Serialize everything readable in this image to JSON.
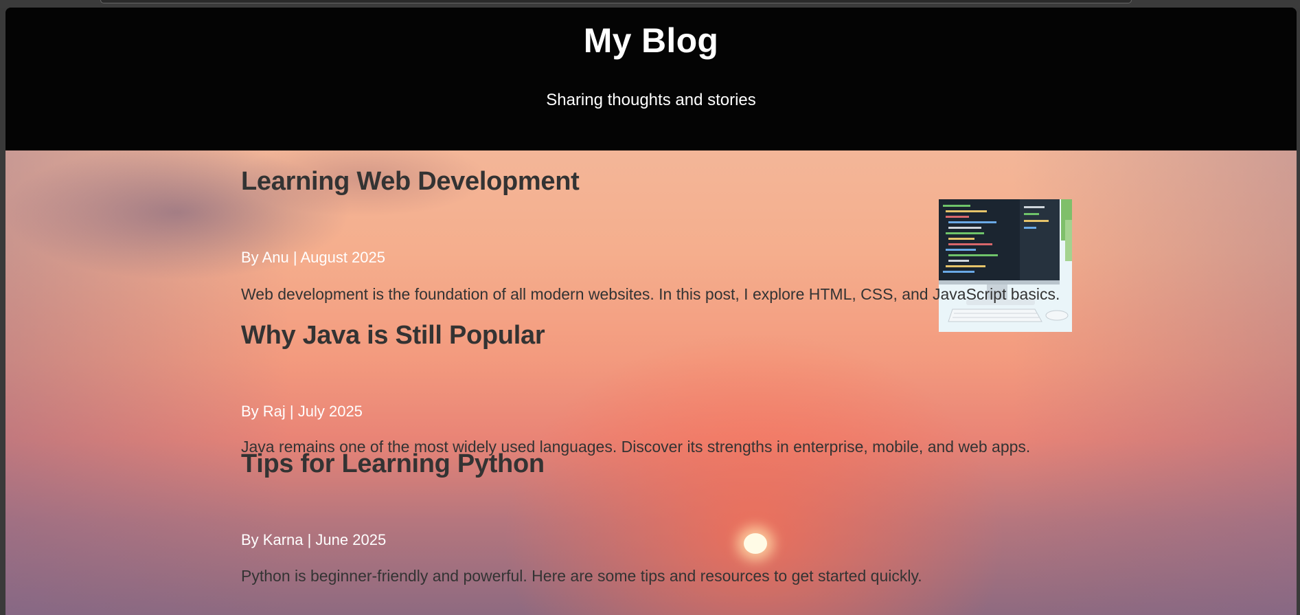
{
  "header": {
    "title": "My Blog",
    "subtitle": "Sharing thoughts and stories"
  },
  "posts": [
    {
      "title": "Learning Web Development",
      "meta": "By Anu | August 2025",
      "body": "Web development is the foundation of all modern websites. In this post, I explore HTML, CSS, and JavaScript basics."
    },
    {
      "title": "Why Java is Still Popular",
      "meta": "By Raj | July 2025",
      "body": "Java remains one of the most widely used languages. Discover its strengths in enterprise, mobile, and web apps."
    },
    {
      "title": "Tips for Learning Python",
      "meta": "By Karna | June 2025",
      "body": "Python is beginner-friendly and powerful. Here are some tips and resources to get started quickly."
    }
  ],
  "thumbnail": {
    "icon": "computer-monitor-code-image"
  },
  "colors": {
    "header_bg": "#040404",
    "header_text": "#ffffff",
    "post_title": "#333333",
    "post_meta": "#ffffff"
  }
}
